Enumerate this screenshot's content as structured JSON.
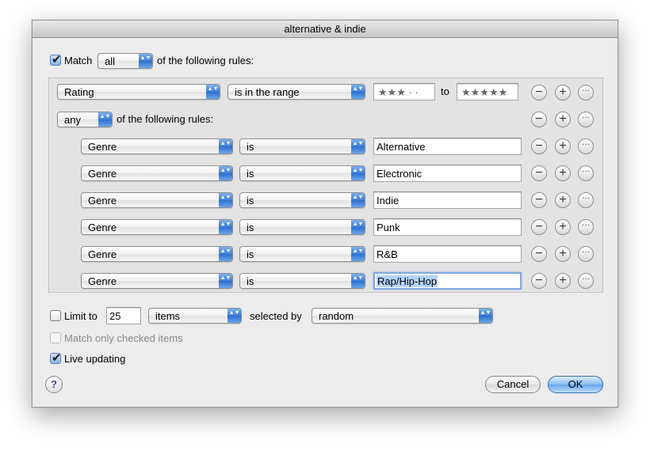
{
  "window": {
    "title": "alternative & indie"
  },
  "match": {
    "checked": true,
    "label": "Match",
    "mode": "all",
    "suffix": "of the following rules:"
  },
  "rating_rule": {
    "field": "Rating",
    "operator": "is in the range",
    "from_stars": "★★★ · ·",
    "to_label": "to",
    "to_stars": "★★★★★"
  },
  "nested": {
    "mode": "any",
    "suffix": "of the following rules:"
  },
  "genre_rules": [
    {
      "field": "Genre",
      "operator": "is",
      "value": "Alternative"
    },
    {
      "field": "Genre",
      "operator": "is",
      "value": "Electronic"
    },
    {
      "field": "Genre",
      "operator": "is",
      "value": "Indie"
    },
    {
      "field": "Genre",
      "operator": "is",
      "value": "Punk"
    },
    {
      "field": "Genre",
      "operator": "is",
      "value": "R&B"
    },
    {
      "field": "Genre",
      "operator": "is",
      "value": "Rap/Hip-Hop"
    }
  ],
  "rule_buttons": {
    "remove": "−",
    "add": "+",
    "more": "···"
  },
  "limit": {
    "checked": false,
    "label": "Limit to",
    "value": "25",
    "unit": "items",
    "selected_by_label": "selected by",
    "selected_by": "random"
  },
  "options": {
    "match_checked_label": "Match only checked items",
    "live_updating_label": "Live updating",
    "live_updating_checked": true
  },
  "buttons": {
    "cancel": "Cancel",
    "ok": "OK",
    "help": "?"
  },
  "popup_arrows": "▲▼",
  "checkmark": "✔"
}
